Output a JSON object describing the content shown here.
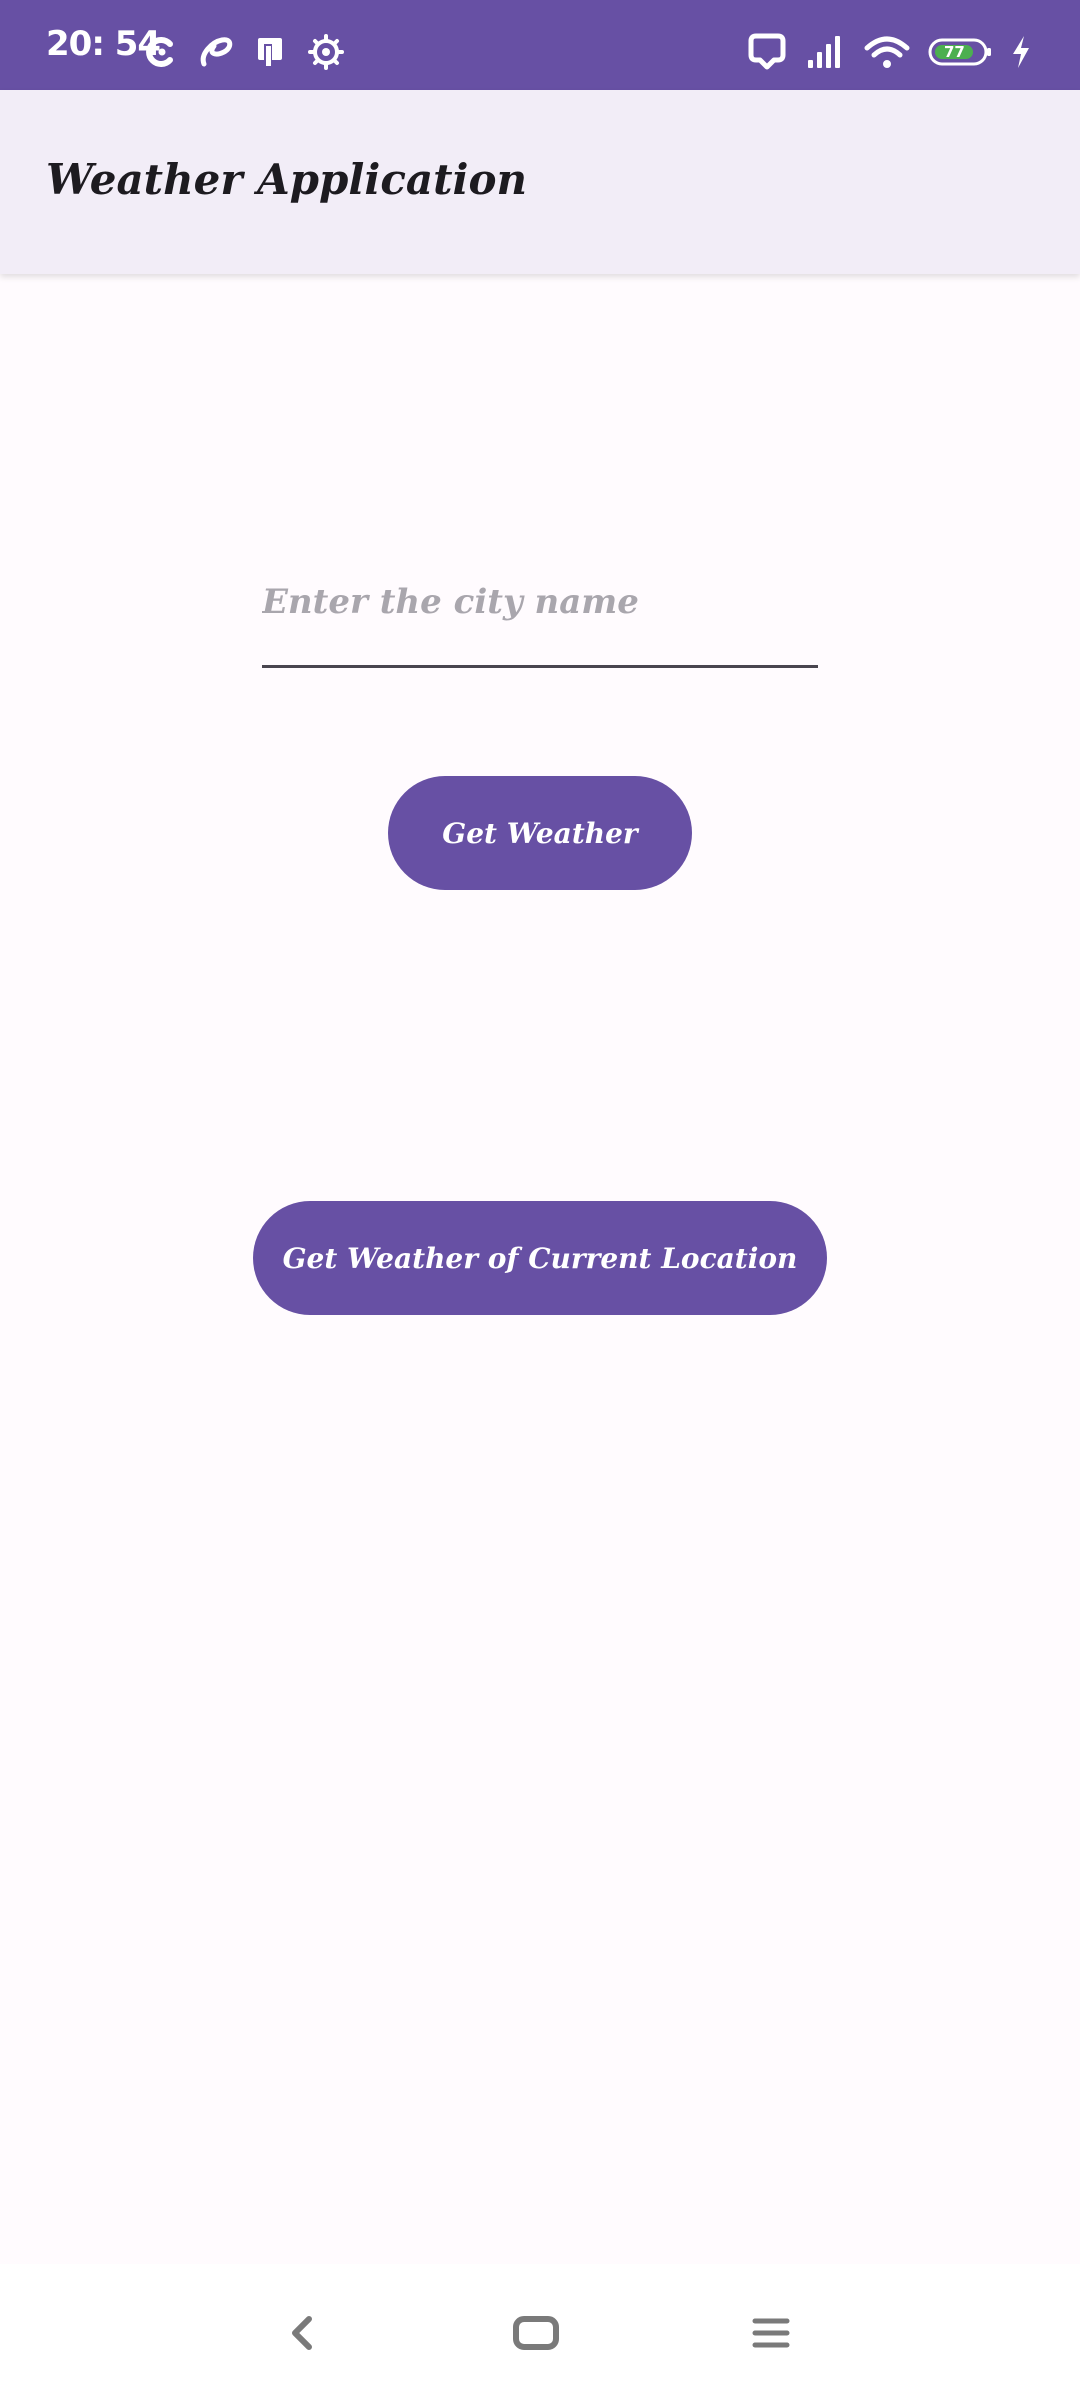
{
  "status_bar": {
    "time": "20: 54",
    "battery_level": "77",
    "background_color": "#6750a4",
    "left_icons": [
      "data-saver-icon",
      "airtel-icon",
      "sim-card-icon",
      "settings-gear-icon"
    ],
    "right_icons": [
      "alarm-icon",
      "signal-icon",
      "wifi-icon",
      "battery-icon",
      "charging-icon"
    ]
  },
  "app_bar": {
    "title": "Weather Application",
    "background_color": "#f2edf7"
  },
  "city_input": {
    "placeholder": "Enter the city name",
    "value": ""
  },
  "buttons": {
    "get_weather": "Get Weather",
    "get_current_location": "Get Weather of Current Location",
    "color": "#6750a4"
  },
  "nav_bar": {
    "icons": [
      "back-icon",
      "home-icon",
      "menu-icon"
    ]
  }
}
